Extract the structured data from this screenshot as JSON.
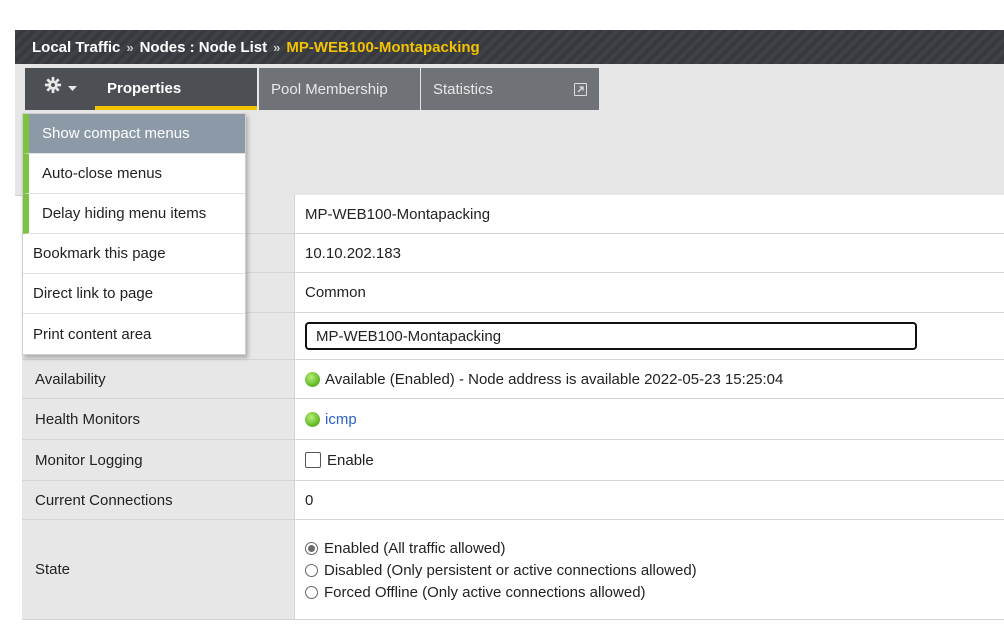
{
  "breadcrumb": {
    "part1": "Local Traffic",
    "part2": "Nodes : Node List",
    "current": "MP-WEB100-Montapacking",
    "separator": "»"
  },
  "tabs": {
    "gear_icon": "gear-icon",
    "properties": "Properties",
    "pool_membership": "Pool Membership",
    "statistics": "Statistics"
  },
  "menu": {
    "items": [
      "Show compact menus",
      "Auto-close menus",
      "Delay hiding menu items",
      "Bookmark this page",
      "Direct link to page",
      "Print content area"
    ]
  },
  "properties": {
    "name_value": "MP-WEB100-Montapacking",
    "address_value": "10.10.202.183",
    "partition_value": "Common",
    "description_value": "MP-WEB100-Montapacking",
    "availability_label": "Availability",
    "availability_value": "Available (Enabled) - Node address is available 2022-05-23 15:25:04",
    "health_label": "Health Monitors",
    "health_value": "icmp",
    "logging_label": "Monitor Logging",
    "logging_value": "Enable",
    "connections_label": "Current Connections",
    "connections_value": "0",
    "state_label": "State",
    "state_options": [
      "Enabled (All traffic allowed)",
      "Disabled (Only persistent or active connections allowed)",
      "Forced Offline (Only active connections allowed)"
    ]
  },
  "colors": {
    "accent": "#f3c200",
    "status_green": "#6cc22e",
    "menu_highlight": "#8b9aa6"
  }
}
